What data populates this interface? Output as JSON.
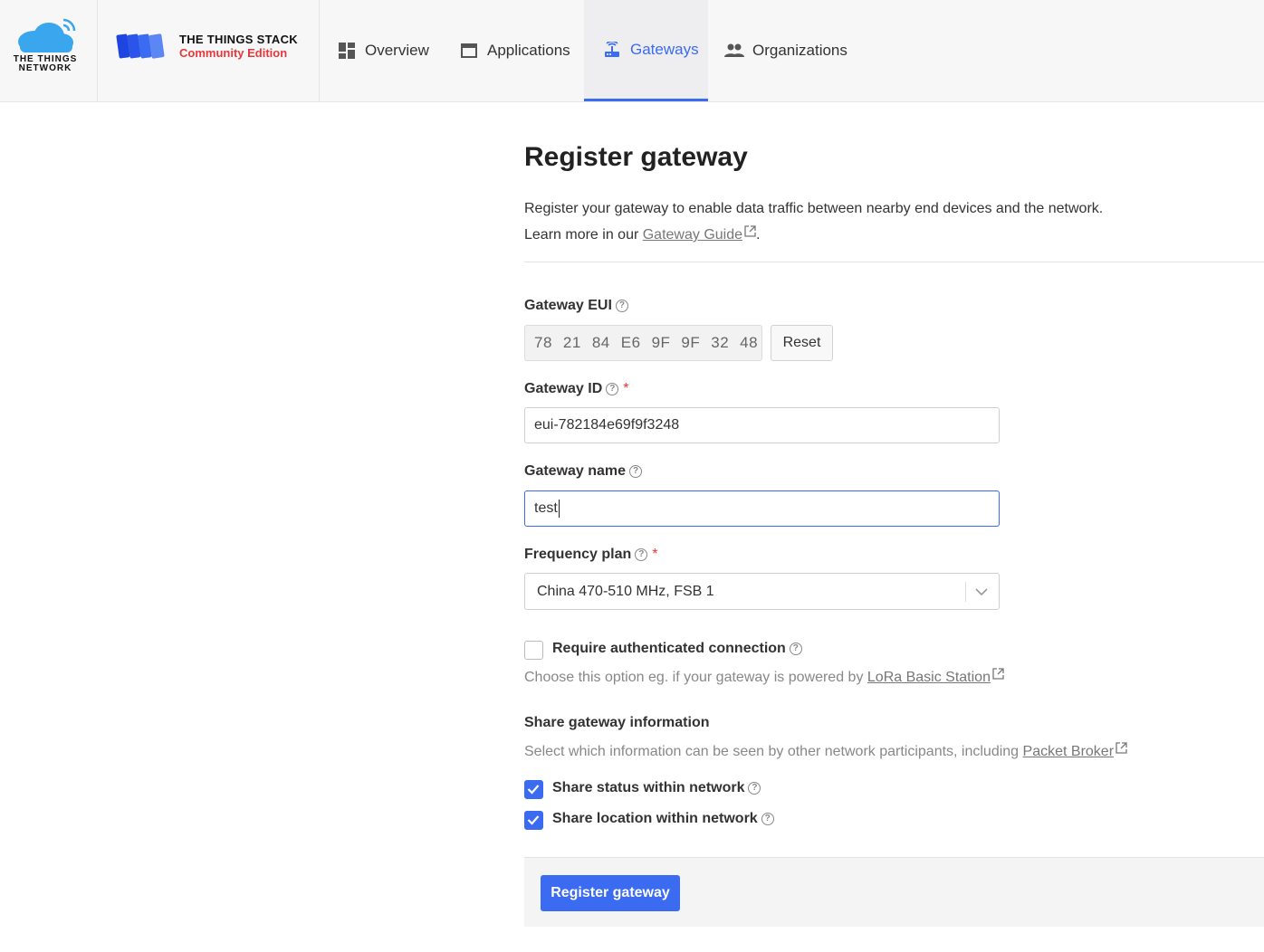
{
  "brand": {
    "ttn_line1": "THE THINGS",
    "ttn_line2": "NETWORK",
    "stack_title": "THE THINGS STACK",
    "stack_edition": "Community Edition",
    "accent": "#3b6bf0",
    "edition_color": "#e8373a"
  },
  "nav": {
    "items": [
      {
        "label": "Overview",
        "icon": "dashboard-icon"
      },
      {
        "label": "Applications",
        "icon": "window-icon"
      },
      {
        "label": "Gateways",
        "icon": "router-icon",
        "active": true
      },
      {
        "label": "Organizations",
        "icon": "people-icon"
      }
    ]
  },
  "page": {
    "title": "Register gateway",
    "description_line1": "Register your gateway to enable data traffic between nearby end devices and the network.",
    "description_prefix": "Learn more in our ",
    "guide_link": "Gateway Guide",
    "description_suffix": "."
  },
  "form": {
    "eui_label": "Gateway EUI",
    "eui_bytes": [
      "78",
      "21",
      "84",
      "E6",
      "9F",
      "9F",
      "32",
      "48"
    ],
    "reset_label": "Reset",
    "id_label": "Gateway ID",
    "id_value": "eui-782184e69f9f3248",
    "name_label": "Gateway name",
    "name_value": "test",
    "freq_label": "Frequency plan",
    "freq_value": "China 470-510 MHz, FSB 1",
    "required_mark": "*",
    "auth_label": "Require authenticated connection",
    "auth_checked": false,
    "auth_hint_prefix": "Choose this option eg. if your gateway is powered by ",
    "auth_hint_link": "LoRa Basic Station",
    "share_title": "Share gateway information",
    "share_hint_prefix": "Select which information can be seen by other network participants, including ",
    "share_hint_link": "Packet Broker",
    "share_status_label": "Share status within network",
    "share_status_checked": true,
    "share_location_label": "Share location within network",
    "share_location_checked": true,
    "submit_label": "Register gateway"
  }
}
